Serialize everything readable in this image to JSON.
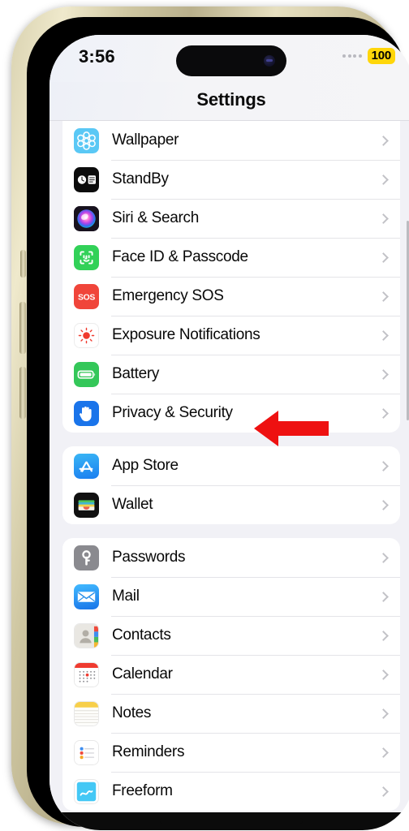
{
  "device": {
    "frame_color": "#d9d2b0",
    "screen_bg": "#f1f1f6"
  },
  "status_bar": {
    "time": "3:56",
    "battery_level": "100",
    "battery_badge_color": "#FFD60A",
    "signal_dots": 4,
    "dynamic_island": "dynamic-island"
  },
  "nav": {
    "title": "Settings"
  },
  "annotation": {
    "type": "left-arrow",
    "color": "#EE1111",
    "points_at": "Privacy & Security"
  },
  "groups": [
    {
      "id": "group-system",
      "rows": [
        {
          "label": "Wallpaper",
          "icon": "wallpaper-icon",
          "icon_class": "ic-wallpaper",
          "chevron": "chevron-right-icon"
        },
        {
          "label": "StandBy",
          "icon": "standby-icon",
          "icon_class": "ic-standby",
          "chevron": "chevron-right-icon"
        },
        {
          "label": "Siri & Search",
          "icon": "siri-icon",
          "icon_class": "ic-siri",
          "chevron": "chevron-right-icon"
        },
        {
          "label": "Face ID & Passcode",
          "icon": "face-id-icon",
          "icon_class": "ic-faceid",
          "chevron": "chevron-right-icon"
        },
        {
          "label": "Emergency SOS",
          "icon": "emergency-sos-icon",
          "icon_class": "ic-sos",
          "chevron": "chevron-right-icon"
        },
        {
          "label": "Exposure Notifications",
          "icon": "exposure-notifications-icon",
          "icon_class": "ic-exposure",
          "chevron": "chevron-right-icon"
        },
        {
          "label": "Battery",
          "icon": "battery-icon",
          "icon_class": "ic-battery",
          "chevron": "chevron-right-icon"
        },
        {
          "label": "Privacy & Security",
          "icon": "privacy-hand-icon",
          "icon_class": "ic-privacy",
          "chevron": "chevron-right-icon"
        }
      ]
    },
    {
      "id": "group-store",
      "rows": [
        {
          "label": "App Store",
          "icon": "app-store-icon",
          "icon_class": "ic-appstore",
          "chevron": "chevron-right-icon"
        },
        {
          "label": "Wallet",
          "icon": "wallet-icon",
          "icon_class": "ic-wallet",
          "chevron": "chevron-right-icon"
        }
      ]
    },
    {
      "id": "group-apps",
      "rows": [
        {
          "label": "Passwords",
          "icon": "passwords-key-icon",
          "icon_class": "ic-passwords",
          "chevron": "chevron-right-icon"
        },
        {
          "label": "Mail",
          "icon": "mail-icon",
          "icon_class": "ic-mail",
          "chevron": "chevron-right-icon"
        },
        {
          "label": "Contacts",
          "icon": "contacts-icon",
          "icon_class": "ic-contacts",
          "chevron": "chevron-right-icon"
        },
        {
          "label": "Calendar",
          "icon": "calendar-icon",
          "icon_class": "ic-calendar",
          "chevron": "chevron-right-icon"
        },
        {
          "label": "Notes",
          "icon": "notes-icon",
          "icon_class": "ic-notes",
          "chevron": "chevron-right-icon"
        },
        {
          "label": "Reminders",
          "icon": "reminders-icon",
          "icon_class": "ic-reminders",
          "chevron": "chevron-right-icon"
        },
        {
          "label": "Freeform",
          "icon": "freeform-icon",
          "icon_class": "ic-freeform",
          "chevron": "chevron-right-icon"
        }
      ]
    }
  ]
}
